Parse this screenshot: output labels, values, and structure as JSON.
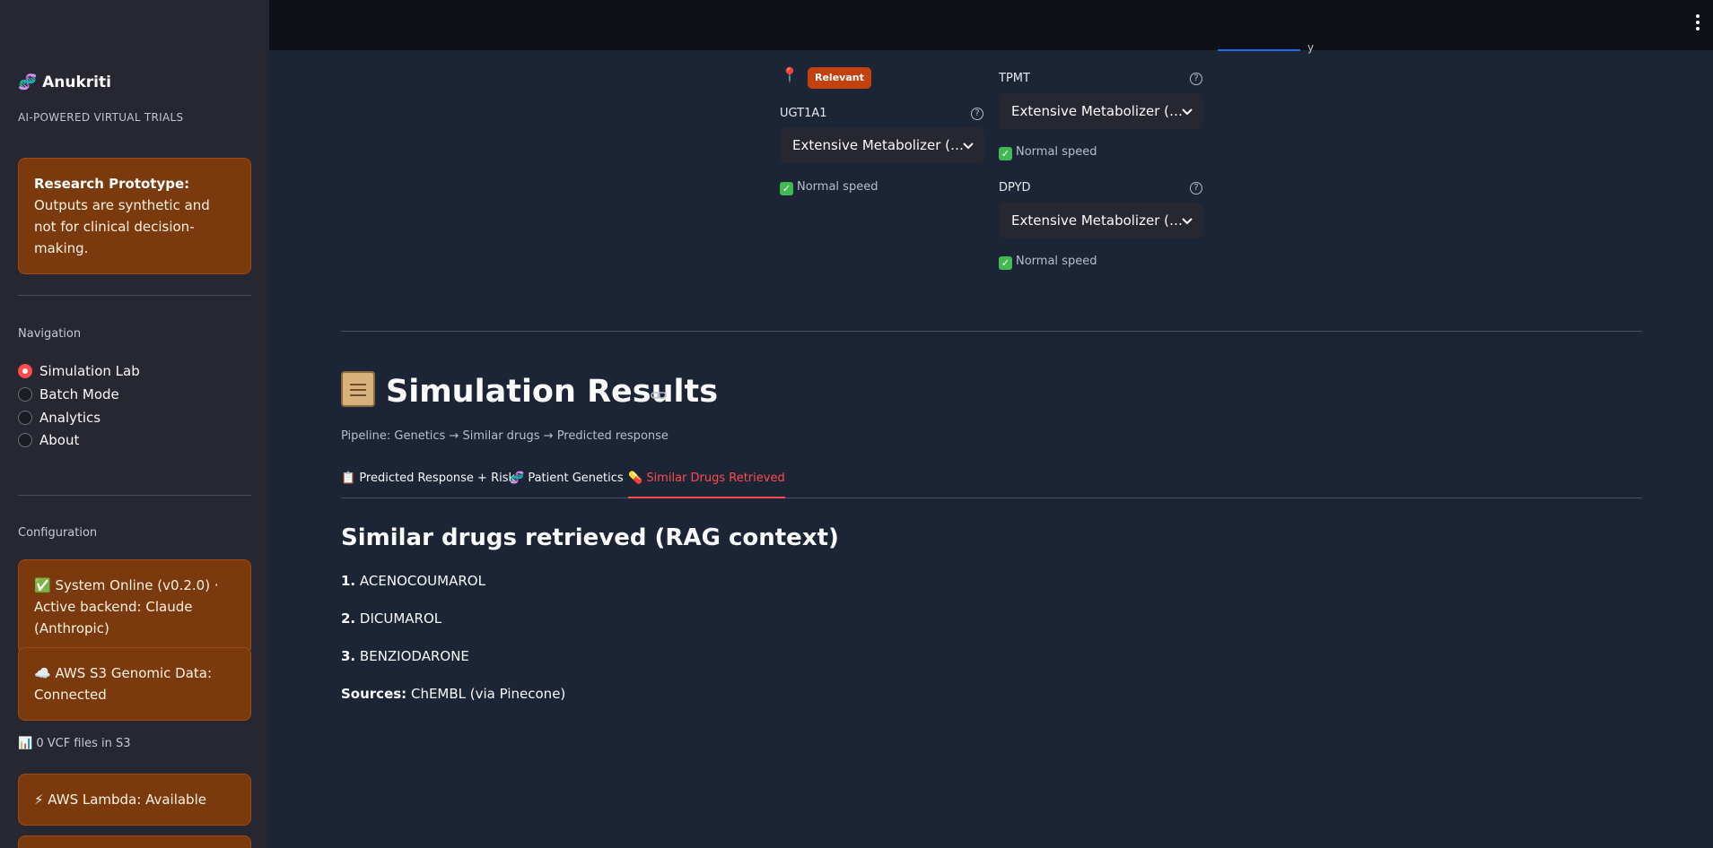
{
  "sidebar": {
    "brand": "🧬 Anukriti",
    "brand_subtitle": "AI-POWERED VIRTUAL TRIALS",
    "disclaimer_bold": "Research Prototype:",
    "disclaimer_text": " Outputs are synthetic and not for clinical decision-making.",
    "navigation_label": "Navigation",
    "nav_items": [
      {
        "label": "Simulation Lab",
        "selected": true
      },
      {
        "label": "Batch Mode",
        "selected": false
      },
      {
        "label": "Analytics",
        "selected": false
      },
      {
        "label": "About",
        "selected": false
      }
    ],
    "configuration_label": "Configuration",
    "status_online": "✅ System Online (v0.2.0) · Active backend: Claude (Anthropic)",
    "status_s3": "☁️ AWS S3 Genomic Data: Connected",
    "vcf_note": "📊 0 VCF files in S3",
    "status_lambda": "⚡ AWS Lambda: Available"
  },
  "header": {
    "partial_text": "y"
  },
  "genetics": {
    "pin": "📍",
    "relevant_badge": "Relevant",
    "genes": [
      {
        "name": "UGT1A1",
        "value": "Extensive Metabolizer (…",
        "status": "Normal speed"
      },
      {
        "name": "TPMT",
        "value": "Extensive Metabolizer (…",
        "status": "Normal speed"
      },
      {
        "name": "DPYD",
        "value": "Extensive Metabolizer (…",
        "status": "Normal speed"
      }
    ]
  },
  "results": {
    "title": "Simulation Results",
    "pipeline": "Pipeline: Genetics → Similar drugs → Predicted response",
    "tabs": [
      {
        "label": "📋 Predicted Response + Risk",
        "active": false
      },
      {
        "label": "🧬 Patient Genetics",
        "active": false
      },
      {
        "label": "💊 Similar Drugs Retrieved",
        "active": true
      }
    ],
    "section_heading": "Similar drugs retrieved (RAG context)",
    "drugs": [
      {
        "num": "1.",
        "name": "ACENOCOUMAROL"
      },
      {
        "num": "2.",
        "name": "DICUMAROL"
      },
      {
        "num": "3.",
        "name": "BENZIODARONE"
      }
    ],
    "sources_label": "Sources:",
    "sources_value": "ChEMBL (via Pinecone)"
  },
  "colors": {
    "accent": "#ff4b4b",
    "warning_bg": "#7b3a0e",
    "badge": "#c2410c",
    "page_bg": "#1c2536",
    "sidebar_bg": "#262730"
  }
}
